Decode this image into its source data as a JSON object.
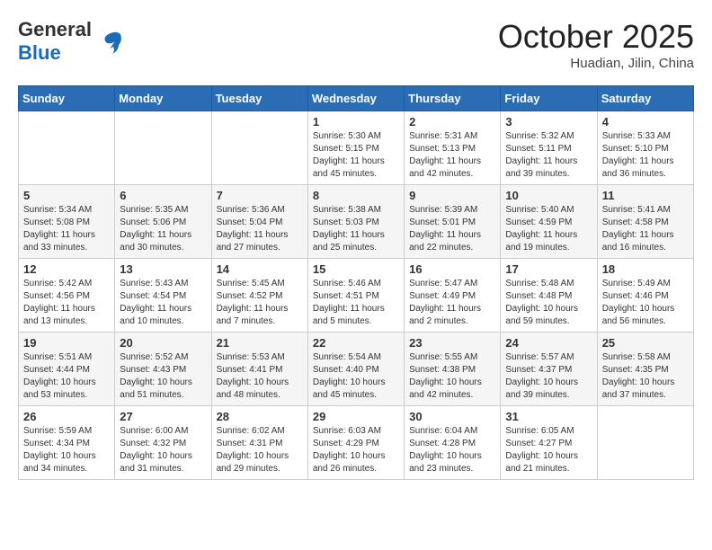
{
  "header": {
    "logo_line1": "General",
    "logo_line2": "Blue",
    "month": "October 2025",
    "location": "Huadian, Jilin, China"
  },
  "weekdays": [
    "Sunday",
    "Monday",
    "Tuesday",
    "Wednesday",
    "Thursday",
    "Friday",
    "Saturday"
  ],
  "weeks": [
    [
      {
        "day": "",
        "info": ""
      },
      {
        "day": "",
        "info": ""
      },
      {
        "day": "",
        "info": ""
      },
      {
        "day": "1",
        "info": "Sunrise: 5:30 AM\nSunset: 5:15 PM\nDaylight: 11 hours and 45 minutes."
      },
      {
        "day": "2",
        "info": "Sunrise: 5:31 AM\nSunset: 5:13 PM\nDaylight: 11 hours and 42 minutes."
      },
      {
        "day": "3",
        "info": "Sunrise: 5:32 AM\nSunset: 5:11 PM\nDaylight: 11 hours and 39 minutes."
      },
      {
        "day": "4",
        "info": "Sunrise: 5:33 AM\nSunset: 5:10 PM\nDaylight: 11 hours and 36 minutes."
      }
    ],
    [
      {
        "day": "5",
        "info": "Sunrise: 5:34 AM\nSunset: 5:08 PM\nDaylight: 11 hours and 33 minutes."
      },
      {
        "day": "6",
        "info": "Sunrise: 5:35 AM\nSunset: 5:06 PM\nDaylight: 11 hours and 30 minutes."
      },
      {
        "day": "7",
        "info": "Sunrise: 5:36 AM\nSunset: 5:04 PM\nDaylight: 11 hours and 27 minutes."
      },
      {
        "day": "8",
        "info": "Sunrise: 5:38 AM\nSunset: 5:03 PM\nDaylight: 11 hours and 25 minutes."
      },
      {
        "day": "9",
        "info": "Sunrise: 5:39 AM\nSunset: 5:01 PM\nDaylight: 11 hours and 22 minutes."
      },
      {
        "day": "10",
        "info": "Sunrise: 5:40 AM\nSunset: 4:59 PM\nDaylight: 11 hours and 19 minutes."
      },
      {
        "day": "11",
        "info": "Sunrise: 5:41 AM\nSunset: 4:58 PM\nDaylight: 11 hours and 16 minutes."
      }
    ],
    [
      {
        "day": "12",
        "info": "Sunrise: 5:42 AM\nSunset: 4:56 PM\nDaylight: 11 hours and 13 minutes."
      },
      {
        "day": "13",
        "info": "Sunrise: 5:43 AM\nSunset: 4:54 PM\nDaylight: 11 hours and 10 minutes."
      },
      {
        "day": "14",
        "info": "Sunrise: 5:45 AM\nSunset: 4:52 PM\nDaylight: 11 hours and 7 minutes."
      },
      {
        "day": "15",
        "info": "Sunrise: 5:46 AM\nSunset: 4:51 PM\nDaylight: 11 hours and 5 minutes."
      },
      {
        "day": "16",
        "info": "Sunrise: 5:47 AM\nSunset: 4:49 PM\nDaylight: 11 hours and 2 minutes."
      },
      {
        "day": "17",
        "info": "Sunrise: 5:48 AM\nSunset: 4:48 PM\nDaylight: 10 hours and 59 minutes."
      },
      {
        "day": "18",
        "info": "Sunrise: 5:49 AM\nSunset: 4:46 PM\nDaylight: 10 hours and 56 minutes."
      }
    ],
    [
      {
        "day": "19",
        "info": "Sunrise: 5:51 AM\nSunset: 4:44 PM\nDaylight: 10 hours and 53 minutes."
      },
      {
        "day": "20",
        "info": "Sunrise: 5:52 AM\nSunset: 4:43 PM\nDaylight: 10 hours and 51 minutes."
      },
      {
        "day": "21",
        "info": "Sunrise: 5:53 AM\nSunset: 4:41 PM\nDaylight: 10 hours and 48 minutes."
      },
      {
        "day": "22",
        "info": "Sunrise: 5:54 AM\nSunset: 4:40 PM\nDaylight: 10 hours and 45 minutes."
      },
      {
        "day": "23",
        "info": "Sunrise: 5:55 AM\nSunset: 4:38 PM\nDaylight: 10 hours and 42 minutes."
      },
      {
        "day": "24",
        "info": "Sunrise: 5:57 AM\nSunset: 4:37 PM\nDaylight: 10 hours and 39 minutes."
      },
      {
        "day": "25",
        "info": "Sunrise: 5:58 AM\nSunset: 4:35 PM\nDaylight: 10 hours and 37 minutes."
      }
    ],
    [
      {
        "day": "26",
        "info": "Sunrise: 5:59 AM\nSunset: 4:34 PM\nDaylight: 10 hours and 34 minutes."
      },
      {
        "day": "27",
        "info": "Sunrise: 6:00 AM\nSunset: 4:32 PM\nDaylight: 10 hours and 31 minutes."
      },
      {
        "day": "28",
        "info": "Sunrise: 6:02 AM\nSunset: 4:31 PM\nDaylight: 10 hours and 29 minutes."
      },
      {
        "day": "29",
        "info": "Sunrise: 6:03 AM\nSunset: 4:29 PM\nDaylight: 10 hours and 26 minutes."
      },
      {
        "day": "30",
        "info": "Sunrise: 6:04 AM\nSunset: 4:28 PM\nDaylight: 10 hours and 23 minutes."
      },
      {
        "day": "31",
        "info": "Sunrise: 6:05 AM\nSunset: 4:27 PM\nDaylight: 10 hours and 21 minutes."
      },
      {
        "day": "",
        "info": ""
      }
    ]
  ]
}
